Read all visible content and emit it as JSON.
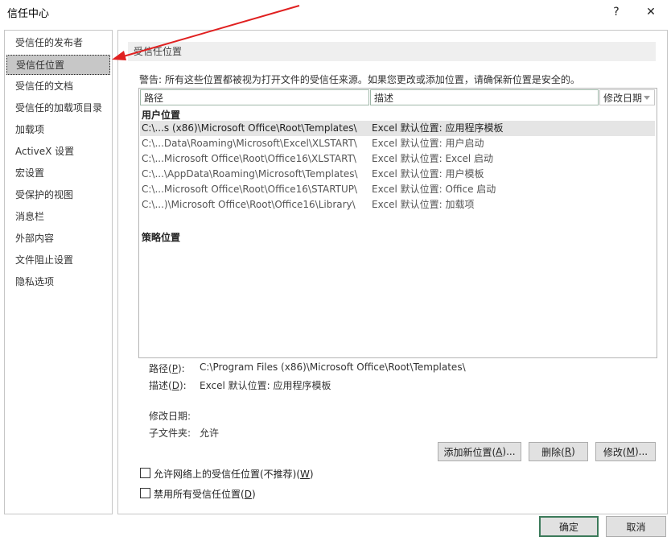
{
  "window": {
    "title": "信任中心",
    "help": "?",
    "close": "✕"
  },
  "sidebar": {
    "items": [
      {
        "label": "受信任的发布者"
      },
      {
        "label": "受信任位置"
      },
      {
        "label": "受信任的文档"
      },
      {
        "label": "受信任的加载项目录"
      },
      {
        "label": "加载项"
      },
      {
        "label": "ActiveX 设置"
      },
      {
        "label": "宏设置"
      },
      {
        "label": "受保护的视图"
      },
      {
        "label": "消息栏"
      },
      {
        "label": "外部内容"
      },
      {
        "label": "文件阻止设置"
      },
      {
        "label": "隐私选项"
      }
    ],
    "selected_index": 1
  },
  "main": {
    "section_title": "受信任位置",
    "warning": "警告: 所有这些位置都被视为打开文件的受信任来源。如果您更改或添加位置，请确保新位置是安全的。",
    "columns": {
      "path": "路径",
      "desc": "描述",
      "date": "修改日期"
    },
    "user_group": "用户位置",
    "policy_group": "策略位置",
    "rows": [
      {
        "path": "C:\\...s (x86)\\Microsoft Office\\Root\\Templates\\",
        "desc": "Excel 默认位置: 应用程序模板"
      },
      {
        "path": "C:\\...Data\\Roaming\\Microsoft\\Excel\\XLSTART\\",
        "desc": "Excel 默认位置: 用户启动"
      },
      {
        "path": "C:\\...Microsoft Office\\Root\\Office16\\XLSTART\\",
        "desc": "Excel 默认位置: Excel 启动"
      },
      {
        "path": "C:\\...\\AppData\\Roaming\\Microsoft\\Templates\\",
        "desc": "Excel 默认位置: 用户模板"
      },
      {
        "path": "C:\\...Microsoft Office\\Root\\Office16\\STARTUP\\",
        "desc": "Excel 默认位置: Office 启动"
      },
      {
        "path": "C:\\...)\\Microsoft Office\\Root\\Office16\\Library\\",
        "desc": "Excel 默认位置: 加载项"
      }
    ],
    "details": {
      "path_label": "路径(",
      "path_key": "P",
      "path_value": "C:\\Program Files (x86)\\Microsoft Office\\Root\\Templates\\",
      "desc_label": "描述(",
      "desc_key": "D",
      "desc_value": "Excel 默认位置: 应用程序模板",
      "date_label": "修改日期:",
      "sub_label": "子文件夹:",
      "sub_value": "允许"
    },
    "buttons": {
      "add": "添加新位置(",
      "add_key": "A",
      "add_tail": ")...",
      "remove": "删除(",
      "remove_key": "R",
      "modify": "修改(",
      "modify_key": "M",
      "modify_tail": ")..."
    },
    "checkboxes": {
      "network": "允许网络上的受信任位置(不推荐)(",
      "network_key": "W",
      "disable_all": "禁用所有受信任位置(",
      "disable_key": "D"
    }
  },
  "footer": {
    "ok": "确定",
    "cancel": "取消"
  },
  "colors": {
    "selected_bg": "#c7c7c7",
    "row_selected_bg": "#e5e5e5",
    "primary_border": "#3c7a5a",
    "arrow": "#e02020"
  }
}
